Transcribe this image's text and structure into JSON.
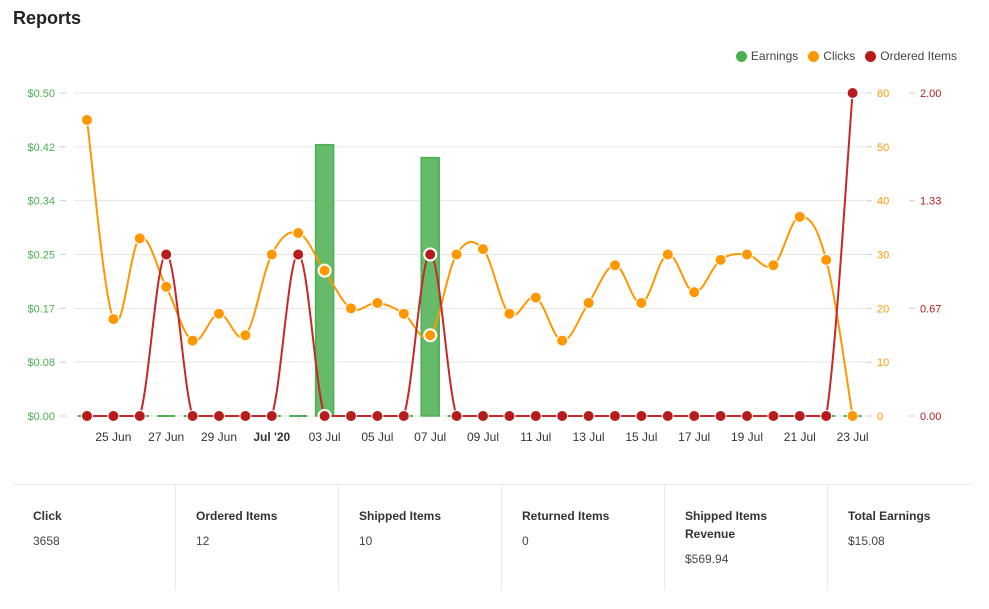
{
  "page": {
    "title": "Reports"
  },
  "legend": [
    {
      "label": "Earnings",
      "color": "#4caf50"
    },
    {
      "label": "Clicks",
      "color": "#ff9800"
    },
    {
      "label": "Ordered Items",
      "color": "#b71c1c"
    }
  ],
  "chart_data": {
    "type": "line",
    "title": "Reports",
    "x": [
      "24 Jun",
      "25 Jun",
      "26 Jun",
      "27 Jun",
      "28 Jun",
      "29 Jun",
      "30 Jun",
      "01 Jul",
      "02 Jul",
      "03 Jul",
      "04 Jul",
      "05 Jul",
      "06 Jul",
      "07 Jul",
      "08 Jul",
      "09 Jul",
      "10 Jul",
      "11 Jul",
      "12 Jul",
      "13 Jul",
      "14 Jul",
      "15 Jul",
      "16 Jul",
      "17 Jul",
      "18 Jul",
      "19 Jul",
      "20 Jul",
      "21 Jul",
      "22 Jul",
      "23 Jul"
    ],
    "x_tick_labels": [
      {
        "index": 1,
        "label": "25 Jun"
      },
      {
        "index": 3,
        "label": "27 Jun"
      },
      {
        "index": 5,
        "label": "29 Jun"
      },
      {
        "index": 7,
        "label": "Jul '20",
        "bold": true
      },
      {
        "index": 9,
        "label": "03 Jul"
      },
      {
        "index": 11,
        "label": "05 Jul"
      },
      {
        "index": 13,
        "label": "07 Jul"
      },
      {
        "index": 15,
        "label": "09 Jul"
      },
      {
        "index": 17,
        "label": "11 Jul"
      },
      {
        "index": 19,
        "label": "13 Jul"
      },
      {
        "index": 21,
        "label": "15 Jul"
      },
      {
        "index": 23,
        "label": "17 Jul"
      },
      {
        "index": 25,
        "label": "19 Jul"
      },
      {
        "index": 27,
        "label": "21 Jul"
      },
      {
        "index": 29,
        "label": "23 Jul"
      }
    ],
    "series": [
      {
        "name": "Earnings",
        "type": "bar",
        "color": "#4caf50",
        "axis": "left",
        "values": [
          0,
          0,
          0,
          0,
          0,
          0,
          0,
          0,
          0,
          0.42,
          0,
          0,
          0,
          0.4,
          0,
          0,
          0,
          0,
          0,
          0,
          0,
          0,
          0,
          0,
          0,
          0,
          0,
          0,
          0,
          0
        ]
      },
      {
        "name": "Clicks",
        "type": "spline",
        "color": "#ff9800",
        "axis": "right1",
        "values": [
          55,
          18,
          33,
          24,
          14,
          19,
          15,
          30,
          34,
          27,
          20,
          21,
          19,
          15,
          30,
          31,
          19,
          22,
          14,
          21,
          28,
          21,
          30,
          23,
          29,
          30,
          28,
          37,
          29,
          0
        ]
      },
      {
        "name": "Ordered Items",
        "type": "spline",
        "color": "#b71c1c",
        "axis": "right2",
        "values": [
          0,
          0,
          0,
          1,
          0,
          0,
          0,
          0,
          1,
          0,
          0,
          0,
          0,
          1,
          0,
          0,
          0,
          0,
          0,
          0,
          0,
          0,
          0,
          0,
          0,
          0,
          0,
          0,
          0,
          2
        ]
      }
    ],
    "y_axes": {
      "left": {
        "ticks": [
          "$0.00",
          "$0.08",
          "$0.17",
          "$0.25",
          "$0.34",
          "$0.42",
          "$0.50"
        ],
        "range": [
          0,
          0.5
        ],
        "color": "#4caf50"
      },
      "right1": {
        "ticks": [
          "0",
          "10",
          "20",
          "30",
          "40",
          "50",
          "60"
        ],
        "range": [
          0,
          60
        ],
        "color": "#ff9800"
      },
      "right2": {
        "ticks": [
          "0.00",
          "0.67",
          "1.33",
          "2.00"
        ],
        "range": [
          0,
          2
        ],
        "color": "#b71c1c"
      }
    },
    "highlighted_index": [
      9,
      13
    ],
    "grid": true,
    "legend_position": "top-right"
  },
  "stats": [
    {
      "label": "Click",
      "value": "3658"
    },
    {
      "label": "Ordered Items",
      "value": "12"
    },
    {
      "label": "Shipped Items",
      "value": "10"
    },
    {
      "label": "Returned Items",
      "value": "0"
    },
    {
      "label": "Shipped Items Revenue",
      "value": "$569.94"
    },
    {
      "label": "Total Earnings",
      "value": "$15.08"
    }
  ]
}
